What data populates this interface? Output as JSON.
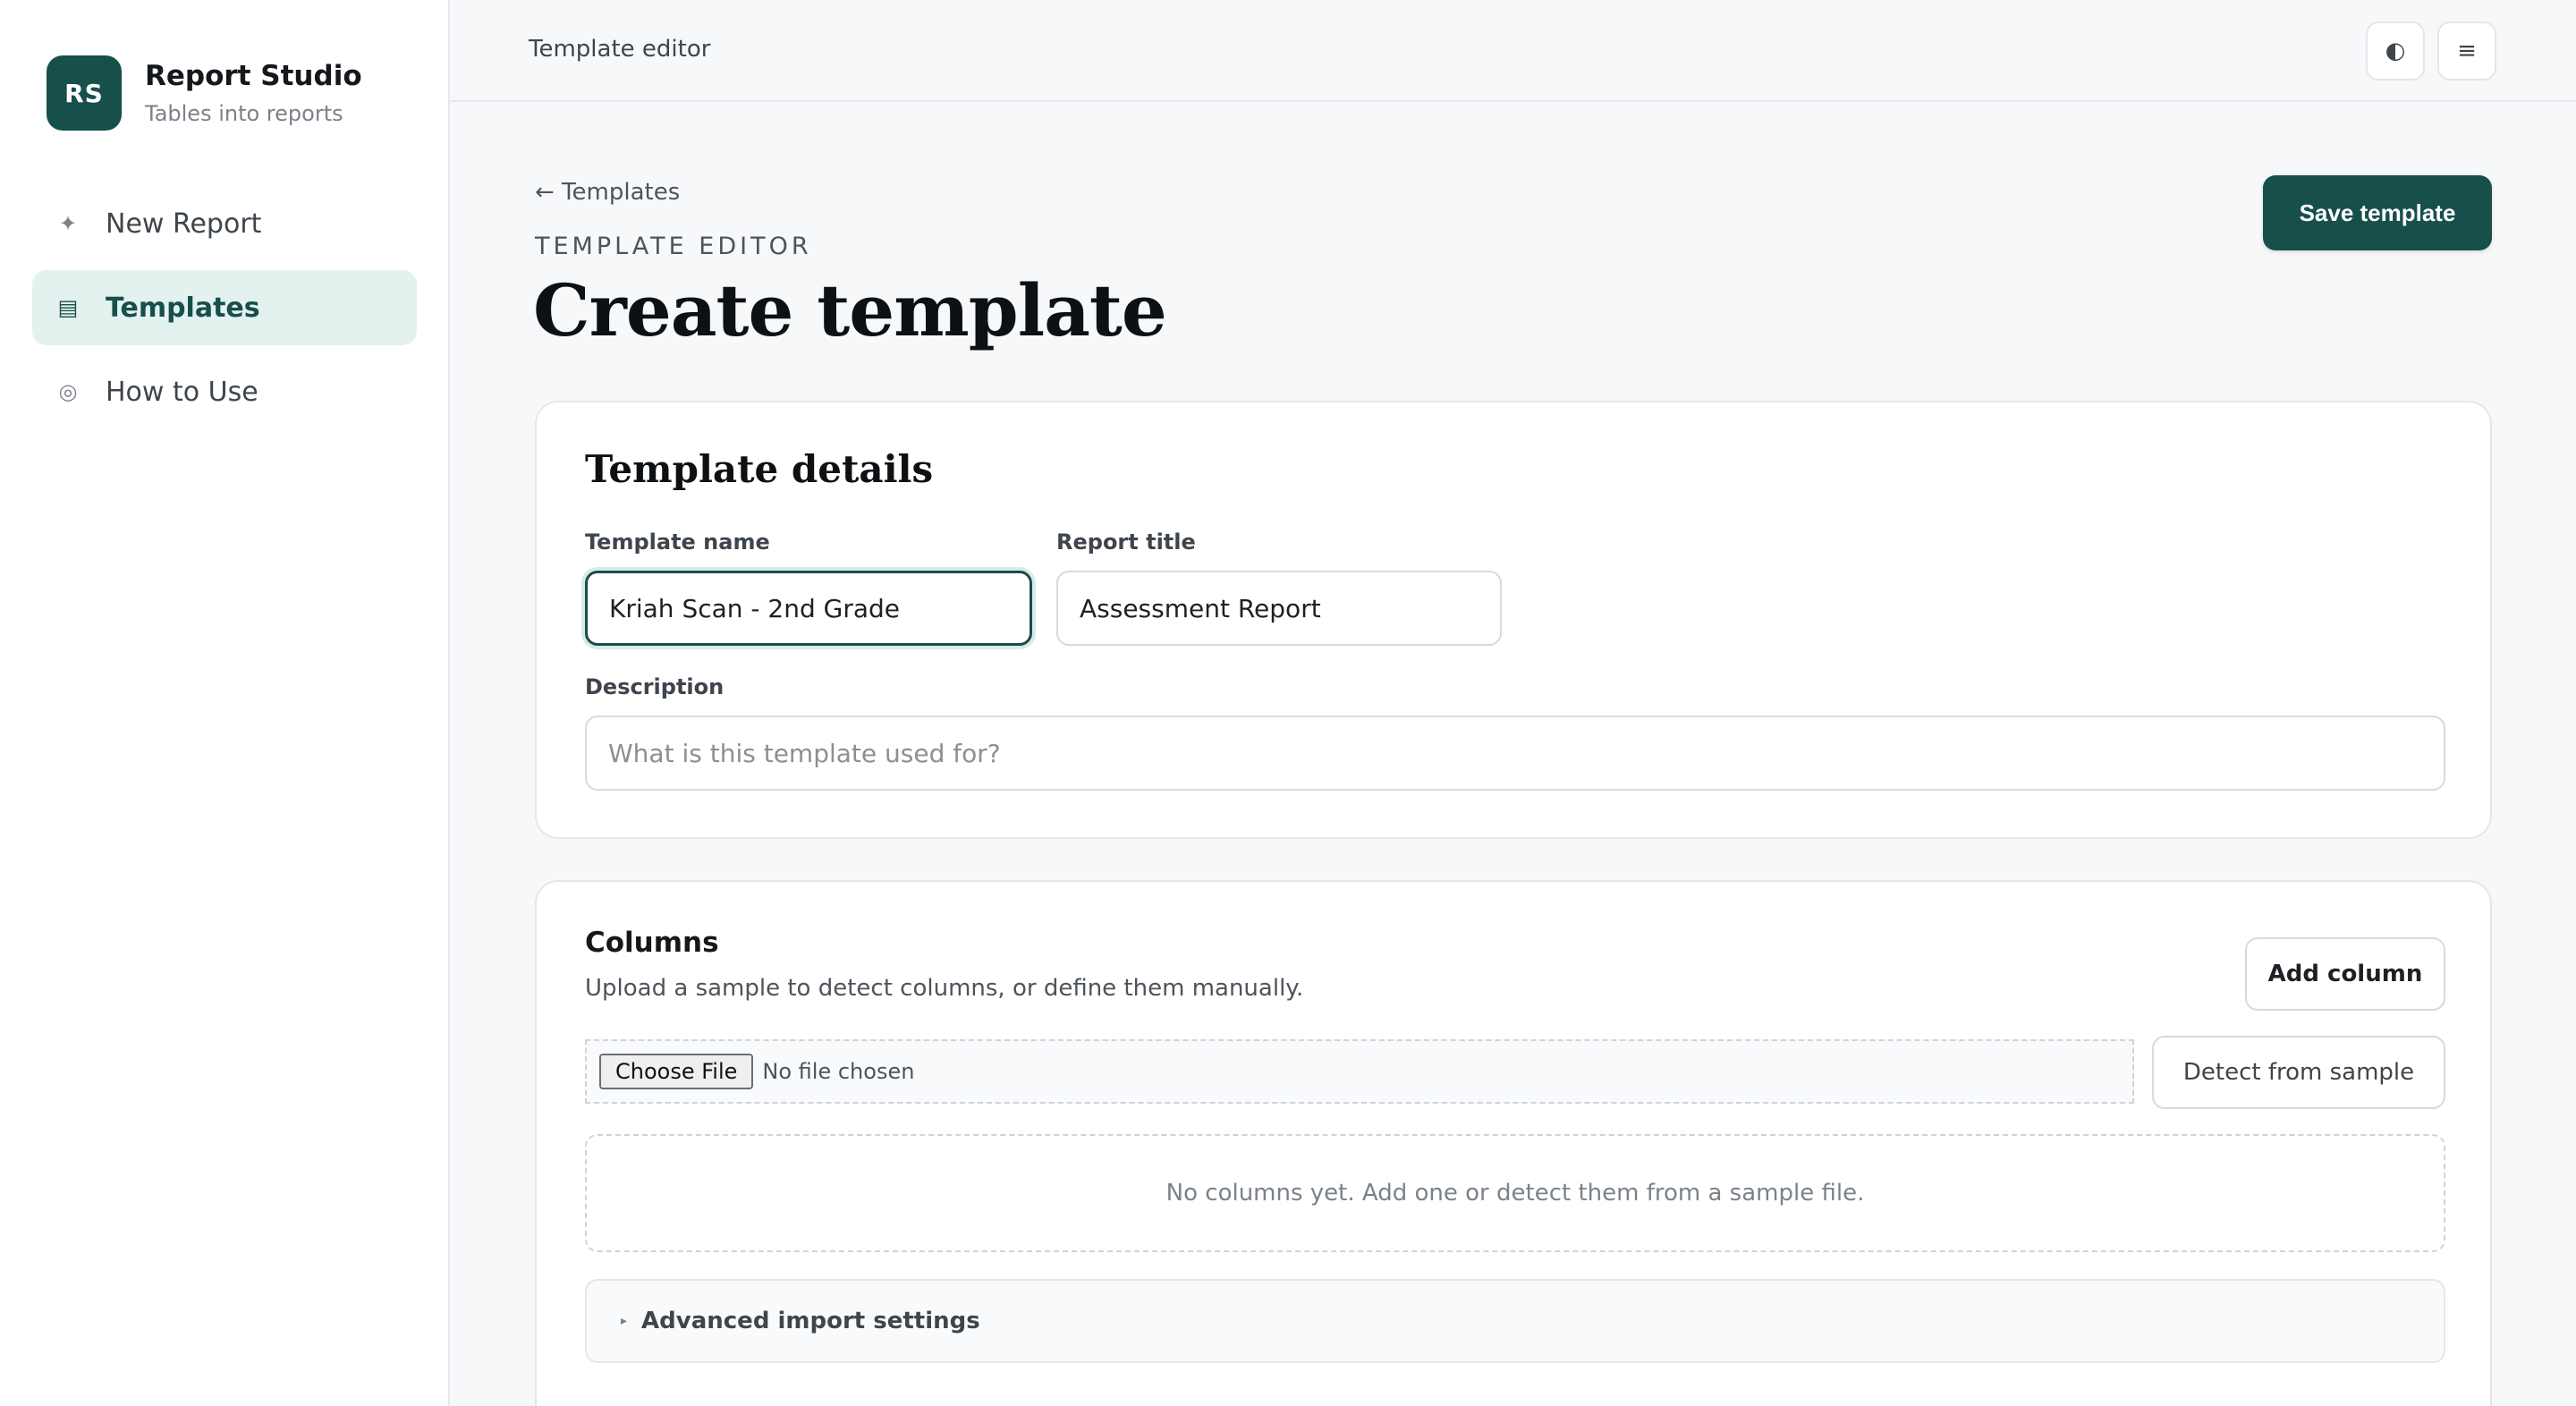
{
  "brand": {
    "initials": "RS",
    "name": "Report Studio",
    "subtitle": "Tables into reports"
  },
  "sidebar": {
    "items": [
      {
        "label": "New Report",
        "icon": "✦",
        "active": false
      },
      {
        "label": "Templates",
        "icon": "▤",
        "active": true
      },
      {
        "label": "How to Use",
        "icon": "◎",
        "active": false
      }
    ]
  },
  "topbar": {
    "title": "Template editor",
    "theme_icon": "◐",
    "menu_icon": "≡"
  },
  "page": {
    "back_label": "← Templates",
    "eyebrow": "TEMPLATE EDITOR",
    "title": "Create template",
    "save_label": "Save template"
  },
  "details": {
    "title": "Template details",
    "template_name_label": "Template name",
    "template_name_value": "Kriah Scan - 2nd Grade",
    "report_title_label": "Report title",
    "report_title_value": "Assessment Report",
    "description_label": "Description",
    "description_placeholder": "What is this template used for?"
  },
  "columns": {
    "title": "Columns",
    "subtitle": "Upload a sample to detect columns, or define them manually.",
    "add_label": "Add column",
    "choose_file_label": "Choose File",
    "file_status": "No file chosen",
    "detect_label": "Detect from sample",
    "empty_text": "No columns yet. Add one or detect them from a sample file.",
    "advanced_label": "Advanced import settings",
    "advanced_caret": "▸"
  },
  "colors": {
    "accent": "#174f4a",
    "accent_light": "#e3f1ef"
  }
}
